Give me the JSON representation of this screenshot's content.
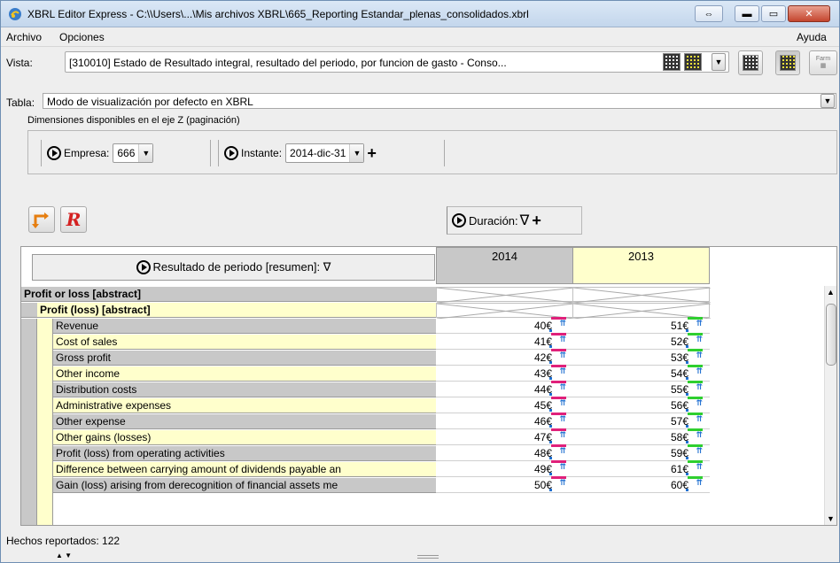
{
  "window": {
    "title": "XBRL Editor Express - C:\\\\Users\\...\\Mis archivos XBRL\\665_Reporting Estandar_plenas_consolidados.xbrl"
  },
  "menu": {
    "archivo": "Archivo",
    "opciones": "Opciones",
    "ayuda": "Ayuda"
  },
  "vista": {
    "label": "Vista:",
    "value": "[310010] Estado de Resultado integral, resultado del periodo, por funcion de gasto - Conso..."
  },
  "farm_icon_label": "Farm",
  "tabla": {
    "label": "Tabla:",
    "value": "Modo de visualización por defecto en XBRL"
  },
  "dims_label": "Dimensiones disponibles en el eje Z (paginación)",
  "z_axis": {
    "empresa_label": "Empresa:",
    "empresa_value": "666",
    "instante_label": "Instante:",
    "instante_value": "2014-dic-31",
    "add_symbol": "+"
  },
  "duracion": {
    "label": "Duración:",
    "filter_symbol": "∇",
    "add_symbol": "+"
  },
  "row_header_title": "Resultado de periodo [resumen]: ∇",
  "columns": [
    "2014",
    "2013"
  ],
  "abstract_rows": [
    "Profit or loss [abstract]",
    "Profit (loss) [abstract]"
  ],
  "rows": [
    {
      "label": "Revenue",
      "v2014": "40€",
      "v2013": "51€"
    },
    {
      "label": "Cost of sales",
      "v2014": "41€",
      "v2013": "52€"
    },
    {
      "label": "Gross profit",
      "v2014": "42€",
      "v2013": "53€"
    },
    {
      "label": "Other income",
      "v2014": "43€",
      "v2013": "54€"
    },
    {
      "label": "Distribution costs",
      "v2014": "44€",
      "v2013": "55€"
    },
    {
      "label": "Administrative expenses",
      "v2014": "45€",
      "v2013": "56€"
    },
    {
      "label": "Other expense",
      "v2014": "46€",
      "v2013": "57€"
    },
    {
      "label": "Other gains (losses)",
      "v2014": "47€",
      "v2013": "58€"
    },
    {
      "label": "Profit (loss) from operating activities",
      "v2014": "48€",
      "v2013": "59€"
    },
    {
      "label": "Difference between carrying amount of dividends payable an",
      "v2014": "49€",
      "v2013": "61€"
    },
    {
      "label": "Gain (loss) arising from derecognition of financial assets me",
      "v2014": "50€",
      "v2013": "60€"
    }
  ],
  "status": {
    "text": "Hechos reportados: 122"
  },
  "colors": {
    "accent_2014": "#e0207a",
    "accent_2013": "#2fcf2f",
    "row_yellow": "#ffffcc",
    "row_gray": "#c8c8c8",
    "col2013_header": "#ffffcc"
  }
}
